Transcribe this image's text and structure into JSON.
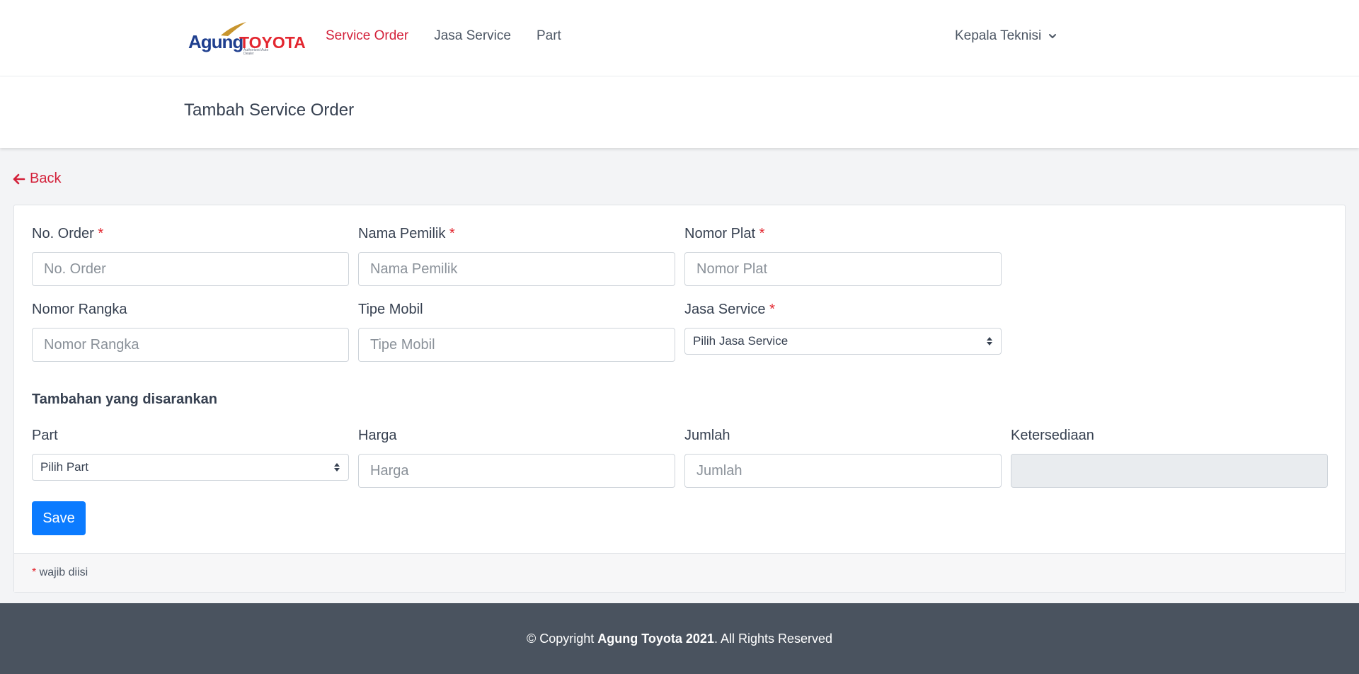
{
  "brand": {
    "logo_text_1": "Agung",
    "logo_text_2": "TOYOTA",
    "logo_subtitle": "Authorized Auto Dealer"
  },
  "nav": {
    "items": [
      {
        "label": "Service Order",
        "active": true
      },
      {
        "label": "Jasa Service",
        "active": false
      },
      {
        "label": "Part",
        "active": false
      }
    ],
    "user_label": "Kepala Teknisi"
  },
  "header": {
    "title": "Tambah Service Order"
  },
  "back": {
    "label": "Back"
  },
  "form": {
    "no_order": {
      "label": "No. Order",
      "required_mark": "*",
      "placeholder": "No. Order",
      "value": ""
    },
    "nama_pemilik": {
      "label": "Nama Pemilik",
      "required_mark": "*",
      "placeholder": "Nama Pemilik",
      "value": ""
    },
    "nomor_plat": {
      "label": "Nomor Plat",
      "required_mark": "*",
      "placeholder": "Nomor Plat",
      "value": ""
    },
    "nomor_rangka": {
      "label": "Nomor Rangka",
      "placeholder": "Nomor Rangka",
      "value": ""
    },
    "tipe_mobil": {
      "label": "Tipe Mobil",
      "placeholder": "Tipe Mobil",
      "value": ""
    },
    "jasa_service": {
      "label": "Jasa Service",
      "required_mark": "*",
      "selected": "Pilih Jasa Service"
    },
    "section_title": "Tambahan yang disarankan",
    "part": {
      "label": "Part",
      "selected": "Pilih Part"
    },
    "harga": {
      "label": "Harga",
      "placeholder": "Harga",
      "value": ""
    },
    "jumlah": {
      "label": "Jumlah",
      "placeholder": "Jumlah",
      "value": ""
    },
    "ketersediaan": {
      "label": "Ketersediaan",
      "value": ""
    },
    "save_label": "Save",
    "footnote_mark": "*",
    "footnote_text": " wajib diisi"
  },
  "footer": {
    "prefix": "© Copyright ",
    "brand": "Agung Toyota 2021",
    "suffix": ". All Rights Reserved"
  },
  "colors": {
    "accent": "#d3213a",
    "primary_button": "#0b7bff",
    "footer_bg": "#4a535f",
    "page_bg": "#f3f4f6"
  },
  "icons": {
    "back": "arrow-left-icon",
    "user_menu": "chevron-down-icon",
    "select": "sort-arrows-icon"
  }
}
